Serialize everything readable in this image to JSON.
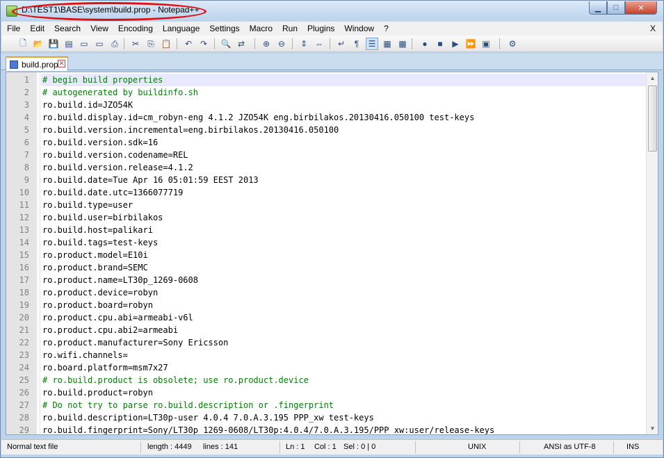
{
  "window": {
    "title": "D:\\TEST1\\BASE\\system\\build.prop - Notepad++",
    "controls": {
      "minimize": "▁",
      "maximize": "□",
      "close": "✕"
    }
  },
  "menu": {
    "items": [
      "File",
      "Edit",
      "Search",
      "View",
      "Encoding",
      "Language",
      "Settings",
      "Macro",
      "Run",
      "Plugins",
      "Window",
      "?"
    ],
    "close": "X"
  },
  "toolbar": {
    "buttons": [
      {
        "name": "new-file-icon",
        "glyph": "🗋"
      },
      {
        "name": "open-file-icon",
        "glyph": "📂"
      },
      {
        "name": "save-icon",
        "glyph": "💾"
      },
      {
        "name": "save-all-icon",
        "glyph": "▤"
      },
      {
        "name": "close-icon",
        "glyph": "▭"
      },
      {
        "name": "close-all-icon",
        "glyph": "▭"
      },
      {
        "name": "print-icon",
        "glyph": "⎙"
      },
      {
        "name": "cut-icon",
        "glyph": "✂"
      },
      {
        "name": "copy-icon",
        "glyph": "⎘"
      },
      {
        "name": "paste-icon",
        "glyph": "📋"
      },
      {
        "name": "undo-icon",
        "glyph": "↶"
      },
      {
        "name": "redo-icon",
        "glyph": "↷"
      },
      {
        "name": "find-icon",
        "glyph": "🔍"
      },
      {
        "name": "replace-icon",
        "glyph": "⇄"
      },
      {
        "name": "zoom-in-icon",
        "glyph": "⊕"
      },
      {
        "name": "zoom-out-icon",
        "glyph": "⊖"
      },
      {
        "name": "sync-vertical-icon",
        "glyph": "⇕"
      },
      {
        "name": "sync-horizontal-icon",
        "glyph": "⇔"
      },
      {
        "name": "word-wrap-icon",
        "glyph": "↵"
      },
      {
        "name": "show-all-chars-icon",
        "glyph": "¶"
      },
      {
        "name": "indent-guide-icon",
        "glyph": "☰"
      },
      {
        "name": "user-defined-language-icon",
        "glyph": "▦"
      },
      {
        "name": "document-map-icon",
        "glyph": "▩"
      },
      {
        "name": "record-macro-icon",
        "glyph": "●"
      },
      {
        "name": "stop-record-icon",
        "glyph": "■"
      },
      {
        "name": "playback-macro-icon",
        "glyph": "▶"
      },
      {
        "name": "run-macro-multiple-icon",
        "glyph": "⏩"
      },
      {
        "name": "save-macro-icon",
        "glyph": "▣"
      },
      {
        "name": "plugin-icon",
        "glyph": "⚙"
      }
    ]
  },
  "tab": {
    "label": "build.prop",
    "close": "✕"
  },
  "editor": {
    "lines": [
      {
        "n": "1",
        "text": "# begin build properties"
      },
      {
        "n": "2",
        "text": "# autogenerated by buildinfo.sh"
      },
      {
        "n": "3",
        "text": "ro.build.id=JZO54K"
      },
      {
        "n": "4",
        "text": "ro.build.display.id=cm_robyn-eng 4.1.2 JZO54K eng.birbilakos.20130416.050100 test-keys"
      },
      {
        "n": "5",
        "text": "ro.build.version.incremental=eng.birbilakos.20130416.050100"
      },
      {
        "n": "6",
        "text": "ro.build.version.sdk=16"
      },
      {
        "n": "7",
        "text": "ro.build.version.codename=REL"
      },
      {
        "n": "8",
        "text": "ro.build.version.release=4.1.2"
      },
      {
        "n": "9",
        "text": "ro.build.date=Tue Apr 16 05:01:59 EEST 2013"
      },
      {
        "n": "10",
        "text": "ro.build.date.utc=1366077719"
      },
      {
        "n": "11",
        "text": "ro.build.type=user"
      },
      {
        "n": "12",
        "text": "ro.build.user=birbilakos"
      },
      {
        "n": "13",
        "text": "ro.build.host=palikari"
      },
      {
        "n": "14",
        "text": "ro.build.tags=test-keys"
      },
      {
        "n": "15",
        "text": "ro.product.model=E10i"
      },
      {
        "n": "16",
        "text": "ro.product.brand=SEMC"
      },
      {
        "n": "17",
        "text": "ro.product.name=LT30p_1269-0608"
      },
      {
        "n": "18",
        "text": "ro.product.device=robyn"
      },
      {
        "n": "19",
        "text": "ro.product.board=robyn"
      },
      {
        "n": "20",
        "text": "ro.product.cpu.abi=armeabi-v6l"
      },
      {
        "n": "21",
        "text": "ro.product.cpu.abi2=armeabi"
      },
      {
        "n": "22",
        "text": "ro.product.manufacturer=Sony Ericsson"
      },
      {
        "n": "23",
        "text": "ro.wifi.channels="
      },
      {
        "n": "24",
        "text": "ro.board.platform=msm7x27"
      },
      {
        "n": "25",
        "text": "# ro.build.product is obsolete; use ro.product.device"
      },
      {
        "n": "26",
        "text": "ro.build.product=robyn"
      },
      {
        "n": "27",
        "text": "# Do not try to parse ro.build.description or .fingerprint"
      },
      {
        "n": "28",
        "text": "ro.build.description=LT30p-user 4.0.4 7.0.A.3.195 PPP_xw test-keys"
      },
      {
        "n": "29",
        "text": "ro.build.fingerprint=Sony/LT30p_1269-0608/LT30p:4.0.4/7.0.A.3.195/PPP_xw:user/release-keys"
      }
    ]
  },
  "scrollbar": {
    "up": "▲",
    "down": "▼"
  },
  "status": {
    "filetype": "Normal text file",
    "length": "length : 4449",
    "lines": "lines : 141",
    "ln": "Ln : 1",
    "col": "Col : 1",
    "sel": "Sel : 0 | 0",
    "eol": "UNIX",
    "encoding": "ANSI as UTF-8",
    "mode": "INS"
  }
}
